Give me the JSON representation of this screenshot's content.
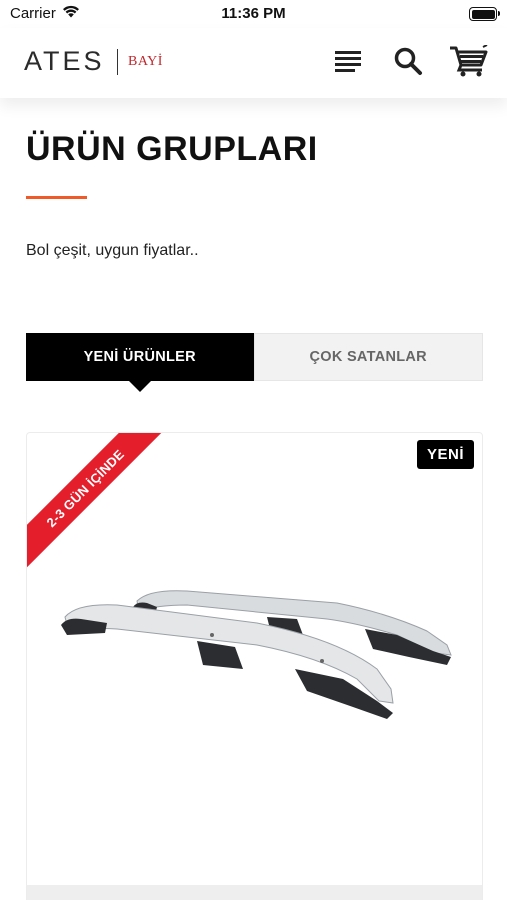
{
  "status_bar": {
    "carrier": "Carrier",
    "time": "11:36 PM"
  },
  "header": {
    "logo_main": "ATES",
    "logo_sub": "BAYİ"
  },
  "page": {
    "title": "ÜRÜN GRUPLARI",
    "subtitle": "Bol çeşit, uygun fiyatlar.."
  },
  "tabs": [
    {
      "label": "YENİ ÜRÜNLER",
      "active": true
    },
    {
      "label": "ÇOK SATANLAR",
      "active": false
    }
  ],
  "product": {
    "ribbon": "2-3 GÜN İÇİNDE",
    "badge": "YENİ"
  },
  "colors": {
    "accent": "#f05a28",
    "ribbon": "#e41e2b",
    "brand_sub": "#c0282d",
    "tab_active": "#000000"
  }
}
